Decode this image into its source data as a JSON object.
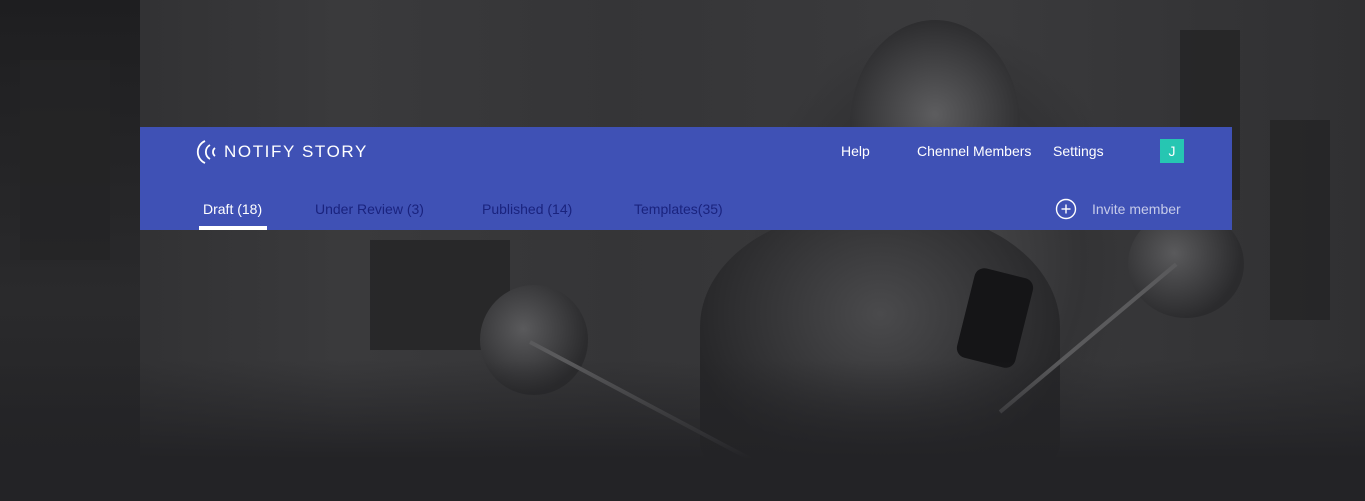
{
  "brand": {
    "name": "NOTIFY STORY",
    "icon": "broadcast-signal-icon"
  },
  "topnav": {
    "help": "Help",
    "members": "Chennel Members",
    "settings": "Settings",
    "avatar_initial": "J"
  },
  "tabs": [
    {
      "label": "Draft (18)",
      "active": true
    },
    {
      "label": "Under Review (3)",
      "active": false
    },
    {
      "label": "Published (14)",
      "active": false
    },
    {
      "label": "Templates(35)",
      "active": false
    }
  ],
  "invite": {
    "label": "Invite member",
    "icon": "plus-circle-icon"
  },
  "colors": {
    "header_bg": "#3f51b5",
    "avatar_bg": "#26c6b2",
    "inactive_tab": "#1a237e",
    "active_tab": "#ffffff"
  }
}
